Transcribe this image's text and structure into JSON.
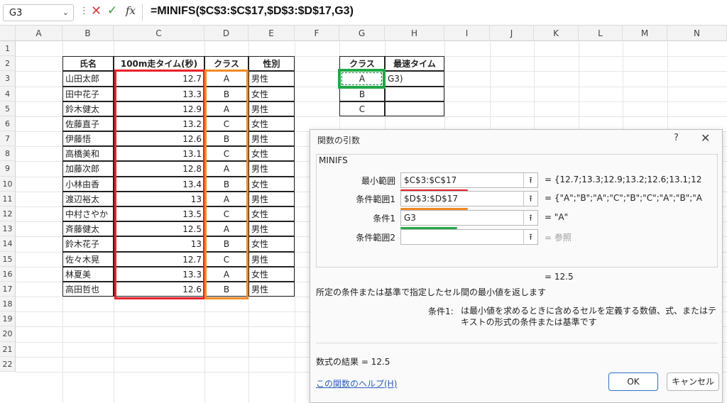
{
  "formula_bar": {
    "name_box": "G3",
    "cancel_icon": "✕",
    "enter_icon": "✓",
    "fx_label": "fx",
    "formula": "=MINIFS($C$3:$C$17,$D$3:$D$17,G3)"
  },
  "columns": [
    "A",
    "B",
    "C",
    "D",
    "E",
    "F",
    "G",
    "H",
    "I",
    "J",
    "K",
    "L",
    "M",
    "N"
  ],
  "rows": [
    "1",
    "2",
    "3",
    "4",
    "5",
    "6",
    "7",
    "8",
    "9",
    "10",
    "11",
    "12",
    "13",
    "14",
    "15",
    "16",
    "17",
    "18",
    "19",
    "20",
    "21",
    "22"
  ],
  "table": {
    "headers": [
      "氏名",
      "100m走タイム(秒)",
      "クラス",
      "性別"
    ],
    "rows": [
      [
        "山田太郎",
        "12.7",
        "A",
        "男性"
      ],
      [
        "田中花子",
        "13.3",
        "B",
        "女性"
      ],
      [
        "鈴木健太",
        "12.9",
        "A",
        "男性"
      ],
      [
        "佐藤直子",
        "13.2",
        "C",
        "女性"
      ],
      [
        "伊藤悟",
        "12.6",
        "B",
        "男性"
      ],
      [
        "高橋美和",
        "13.1",
        "C",
        "女性"
      ],
      [
        "加藤次郎",
        "12.8",
        "A",
        "男性"
      ],
      [
        "小林由香",
        "13.4",
        "B",
        "女性"
      ],
      [
        "渡辺裕太",
        "13",
        "A",
        "男性"
      ],
      [
        "中村さやか",
        "13.5",
        "C",
        "女性"
      ],
      [
        "斉藤健太",
        "12.5",
        "A",
        "男性"
      ],
      [
        "鈴木花子",
        "13",
        "B",
        "女性"
      ],
      [
        "佐々木晃",
        "12.7",
        "C",
        "男性"
      ],
      [
        "林夏美",
        "13.3",
        "A",
        "女性"
      ],
      [
        "高田哲也",
        "12.6",
        "B",
        "男性"
      ]
    ]
  },
  "summary": {
    "headers": [
      "クラス",
      "最速タイム"
    ],
    "rows": [
      [
        "A",
        "G3)"
      ],
      [
        "B",
        ""
      ],
      [
        "C",
        ""
      ]
    ]
  },
  "highlight_colors": {
    "red": "#e8212a",
    "orange": "#f08a24",
    "green": "#22a746"
  },
  "dialog": {
    "title": "関数の引数",
    "help_icon": "?",
    "close_icon": "✕",
    "function_name": "MINIFS",
    "args": [
      {
        "label": "最小範囲",
        "value": "$C$3:$C$17",
        "result": "=  {12.7;13.3;12.9;13.2;12.6;13.1;12",
        "underline": "#e8212a"
      },
      {
        "label": "条件範囲1",
        "value": "$D$3:$D$17",
        "result": "=  {\"A\";\"B\";\"A\";\"C\";\"B\";\"C\";\"A\";\"B\";\"A",
        "underline": "#f08a24"
      },
      {
        "label": "条件1",
        "value": "G3",
        "result": "=  \"A\"",
        "underline": "#22a746"
      },
      {
        "label": "条件範囲2",
        "value": "",
        "result": "=  参照",
        "underline": ""
      }
    ],
    "result_line": "=   12.5",
    "description": "所定の条件または基準で指定したセル間の最小値を返します",
    "cond_label": "条件1:",
    "cond_desc": "は最小値を求めるときに含めるセルを定義する数値、式、またはテキストの形式の条件または基準です",
    "formula_result": "数式の結果 =   12.5",
    "help_link": "この関数のヘルプ(H)",
    "ok": "OK",
    "cancel": "キャンセル"
  }
}
